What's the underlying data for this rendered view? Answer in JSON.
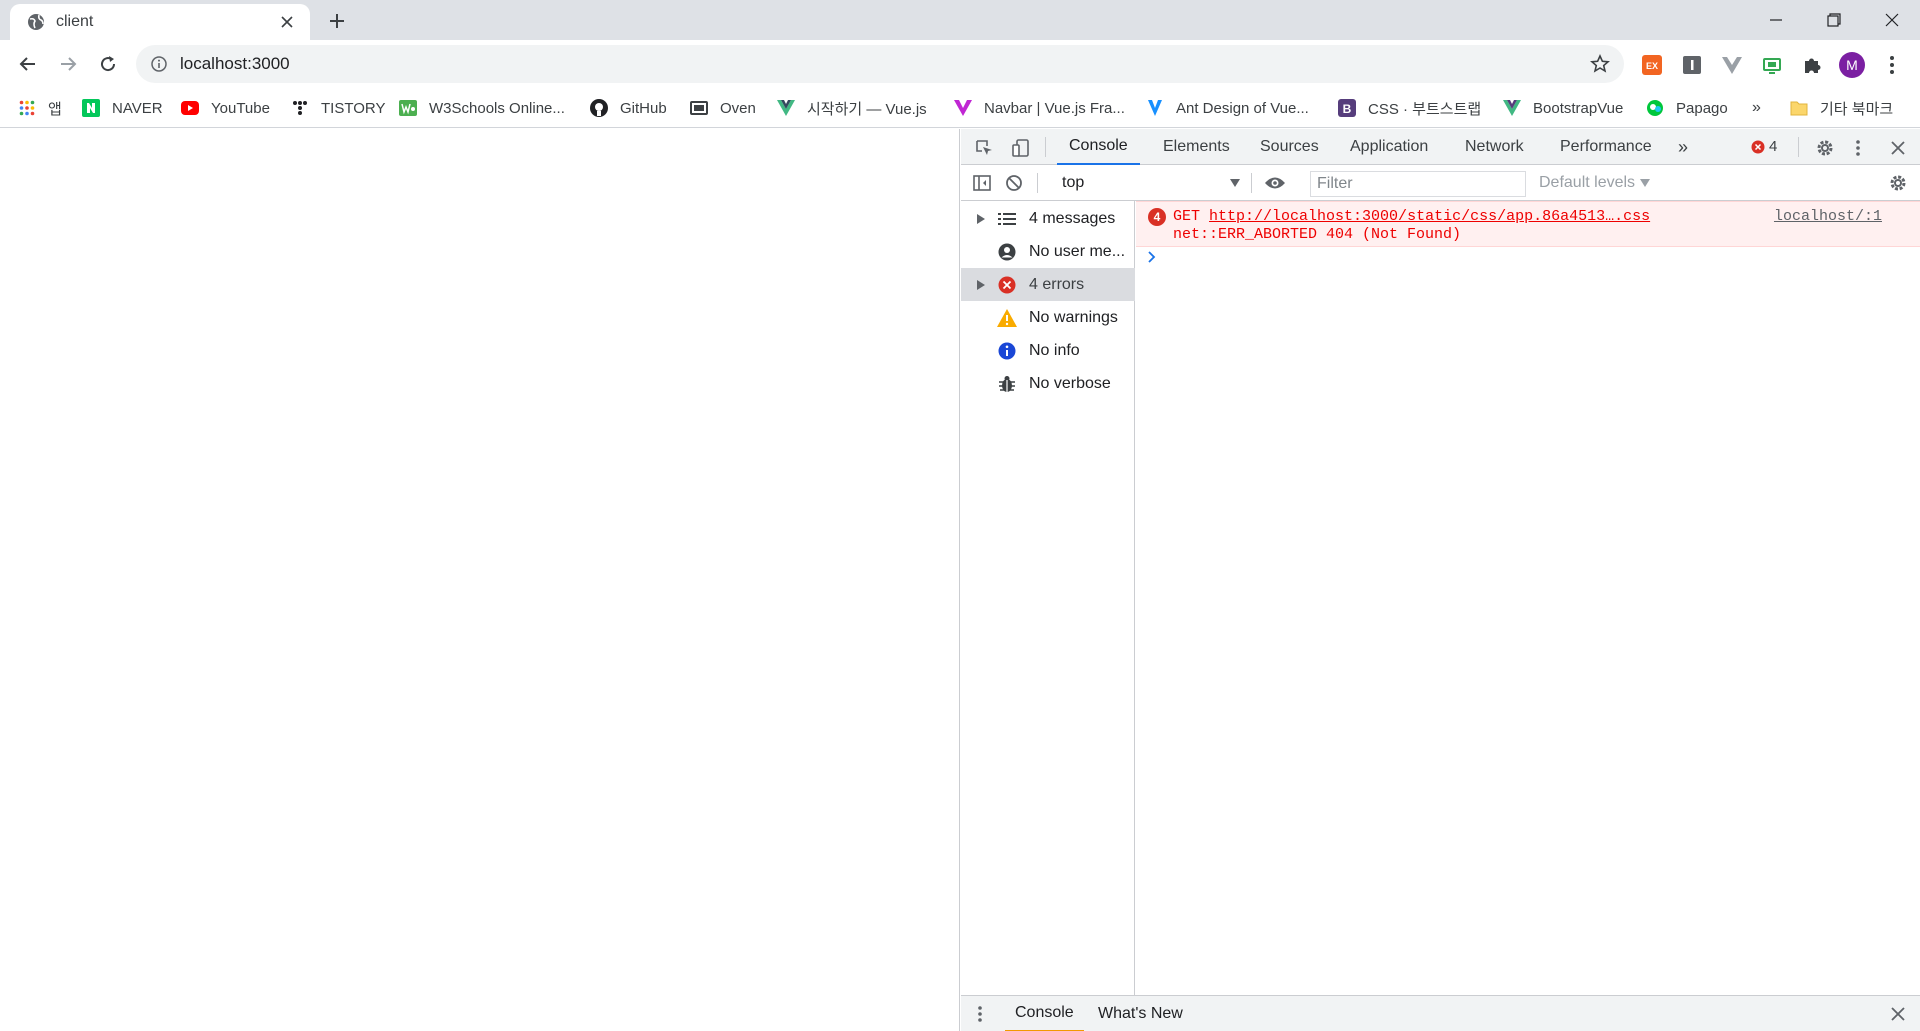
{
  "tab": {
    "title": "client"
  },
  "toolbar": {
    "url": "localhost:3000",
    "profile_initial": "M",
    "ext_badge": "EX"
  },
  "bookmarks": [
    {
      "label": "앱"
    },
    {
      "label": "NAVER"
    },
    {
      "label": "YouTube"
    },
    {
      "label": "TISTORY"
    },
    {
      "label": "W3Schools Online..."
    },
    {
      "label": "GitHub"
    },
    {
      "label": "Oven"
    },
    {
      "label": "시작하기 — Vue.js"
    },
    {
      "label": "Navbar | Vue.js Fra..."
    },
    {
      "label": "Ant Design of Vue..."
    },
    {
      "label": "CSS · 부트스트랩"
    },
    {
      "label": "BootstrapVue"
    },
    {
      "label": "Papago"
    }
  ],
  "bookmarks_overflow": "»",
  "other_bookmarks": "기타 북마크",
  "devtools": {
    "tabs": [
      "Console",
      "Elements",
      "Sources",
      "Application",
      "Network",
      "Performance"
    ],
    "more_tabs": "»",
    "error_count": "4",
    "context": "top",
    "filter_placeholder": "Filter",
    "levels": "Default levels",
    "sidebar": [
      {
        "label": "4 messages"
      },
      {
        "label": "No user me..."
      },
      {
        "label": "4 errors"
      },
      {
        "label": "No warnings"
      },
      {
        "label": "No info"
      },
      {
        "label": "No verbose"
      }
    ],
    "error_message": {
      "count": "4",
      "method": "GET",
      "url": "http://localhost:3000/static/css/app.86a4513….css",
      "detail": "net::ERR_ABORTED 404 (Not Found)",
      "source": "localhost/:1"
    },
    "drawer_tabs": [
      "Console",
      "What's New"
    ]
  },
  "colors": {
    "accent": "#1a73e8",
    "error": "#e00000",
    "error_bg": "#fff0f0",
    "warning": "#f9ab00",
    "profile": "#7b1fa2"
  }
}
